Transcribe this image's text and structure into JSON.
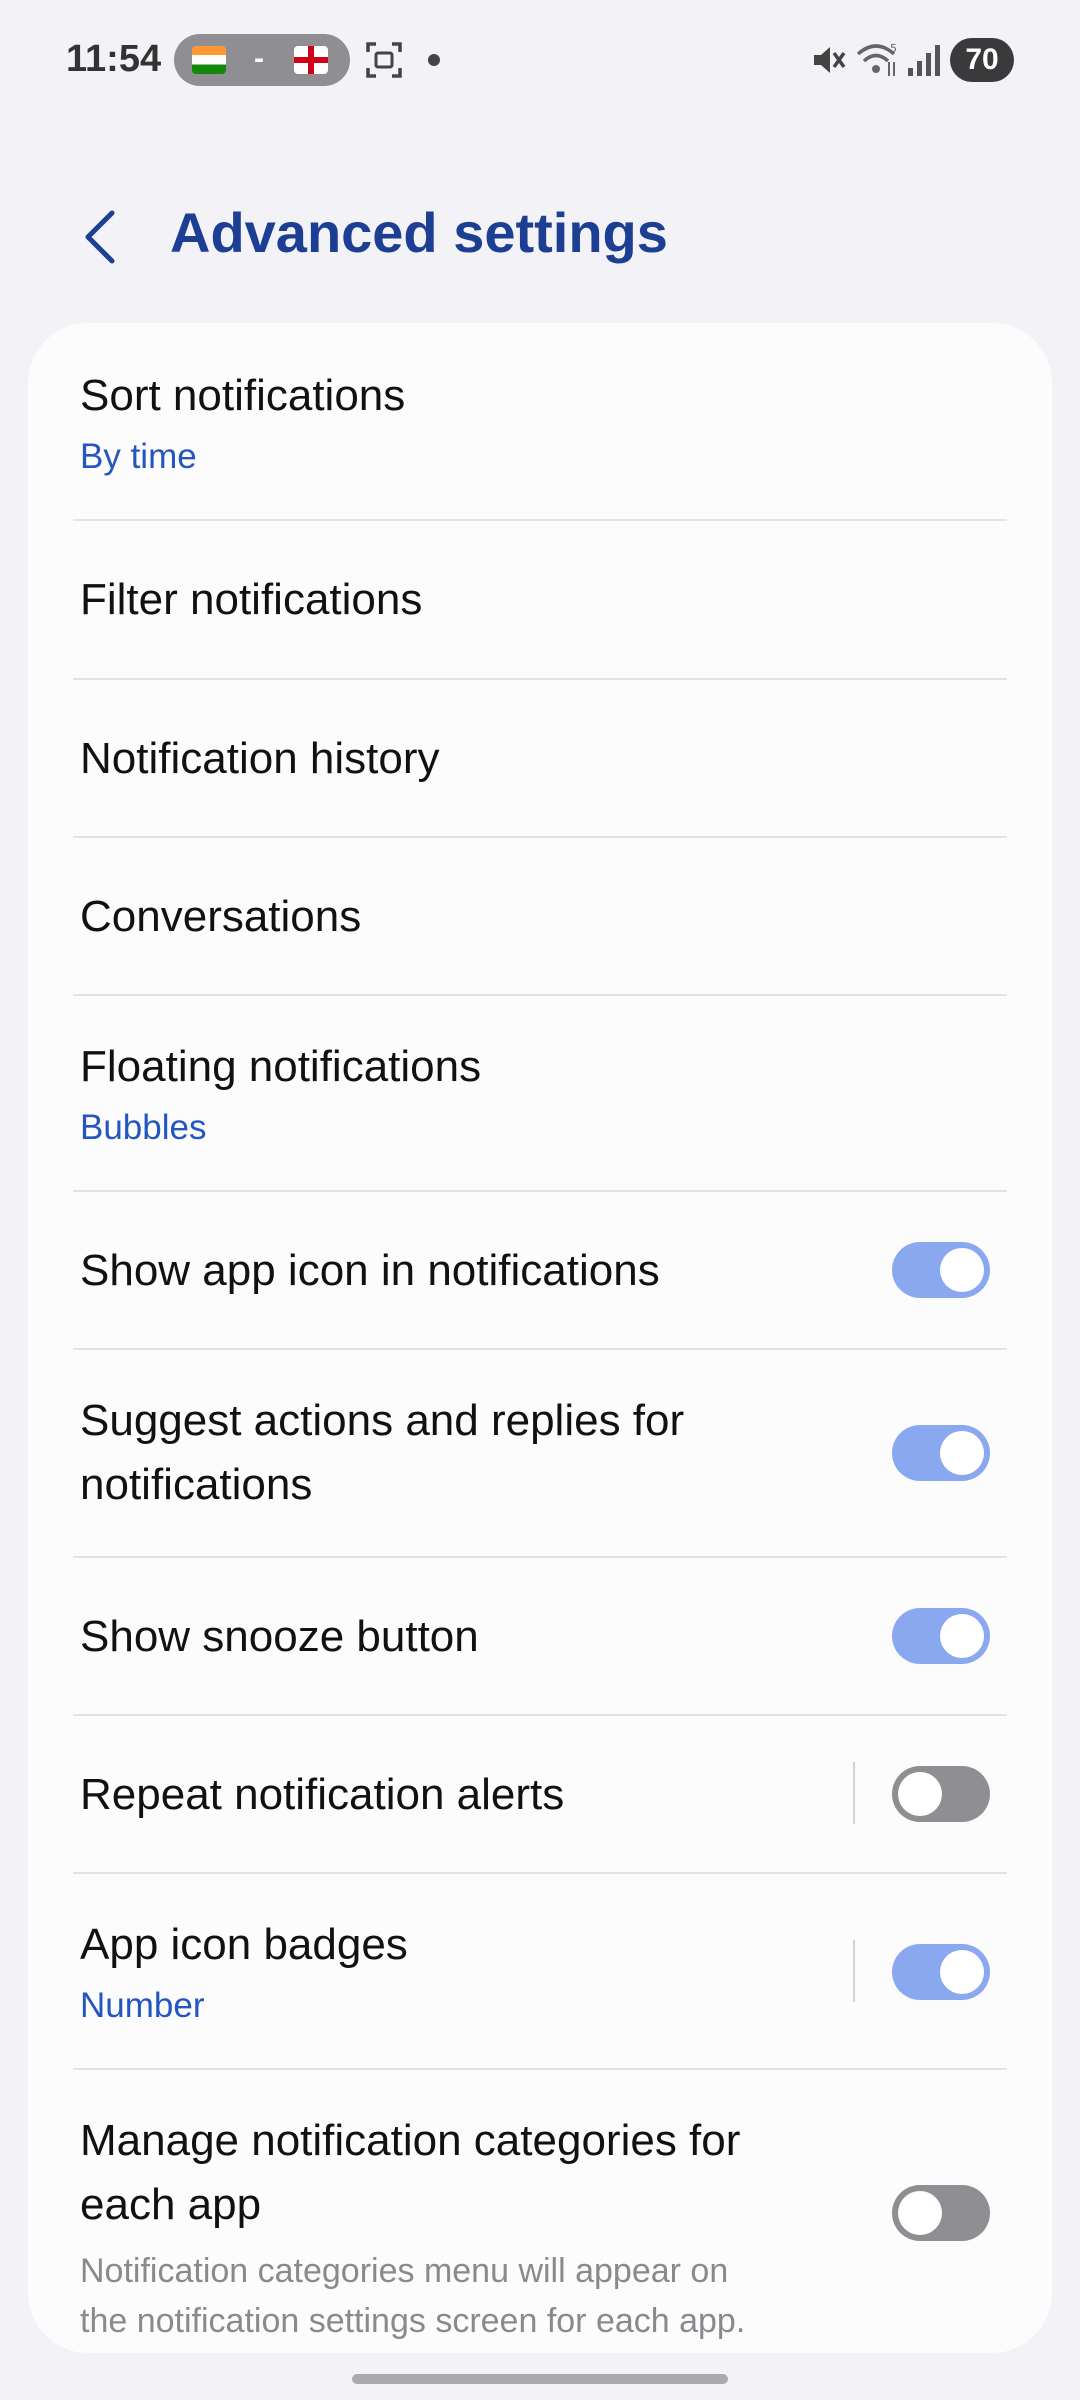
{
  "status_bar": {
    "time": "11:54",
    "flag_separator": "-",
    "battery": "70"
  },
  "header": {
    "title": "Advanced settings"
  },
  "settings": [
    {
      "title": "Sort notifications",
      "subtitle": "By time"
    },
    {
      "title": "Filter notifications"
    },
    {
      "title": "Notification history"
    },
    {
      "title": "Conversations"
    },
    {
      "title": "Floating notifications",
      "subtitle": "Bubbles"
    },
    {
      "title": "Show app icon in notifications",
      "toggle": true
    },
    {
      "title_line1": "Suggest actions and replies for",
      "title_line2": "notifications",
      "toggle": true
    },
    {
      "title": "Show snooze button",
      "toggle": true
    },
    {
      "title": "Repeat notification alerts",
      "toggle": false
    },
    {
      "title": "App icon badges",
      "subtitle": "Number",
      "toggle": true
    },
    {
      "title_line1": "Manage notification categories for",
      "title_line2": "each app",
      "desc_line1": "Notification categories menu will appear on",
      "desc_line2": "the notification settings screen for each app.",
      "toggle": false
    }
  ],
  "colors": {
    "accent": "#1c3f94",
    "subtitle": "#2456c0",
    "toggle_on": "#8aa8f0",
    "toggle_off": "#8e8e93"
  }
}
